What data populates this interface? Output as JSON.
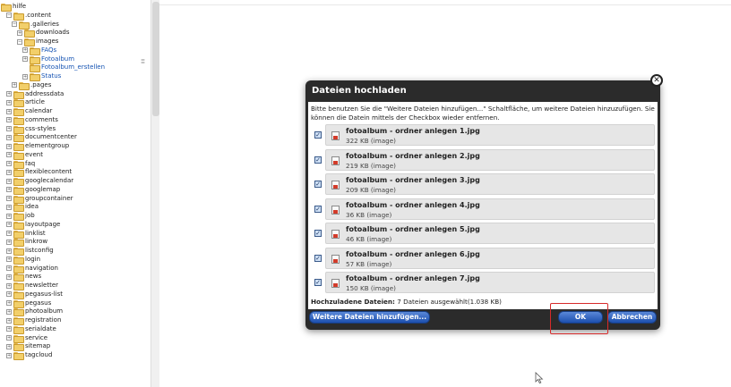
{
  "tree": {
    "items": [
      {
        "label": "hilfe",
        "level": 0,
        "toggle": ""
      },
      {
        "label": ".content",
        "level": 1,
        "toggle": "−"
      },
      {
        "label": ".galleries",
        "level": 2,
        "toggle": "−"
      },
      {
        "label": "downloads",
        "level": 3,
        "toggle": "+"
      },
      {
        "label": "images",
        "level": 3,
        "toggle": "−"
      },
      {
        "label": "FAQs",
        "level": 4,
        "toggle": "+",
        "blue": true
      },
      {
        "label": "Fotoalbum",
        "level": 4,
        "toggle": "+",
        "blue": true
      },
      {
        "label": "Fotoalbum_erstellen",
        "level": 4,
        "toggle": "",
        "blue": true
      },
      {
        "label": "Status",
        "level": 4,
        "toggle": "+",
        "blue": true
      },
      {
        "label": ".pages",
        "level": 2,
        "toggle": "+"
      },
      {
        "label": "addressdata",
        "level": 1,
        "toggle": "+"
      },
      {
        "label": "article",
        "level": 1,
        "toggle": "+"
      },
      {
        "label": "calendar",
        "level": 1,
        "toggle": "+"
      },
      {
        "label": "comments",
        "level": 1,
        "toggle": "+"
      },
      {
        "label": "css-styles",
        "level": 1,
        "toggle": "+"
      },
      {
        "label": "documentcenter",
        "level": 1,
        "toggle": "+"
      },
      {
        "label": "elementgroup",
        "level": 1,
        "toggle": "+"
      },
      {
        "label": "event",
        "level": 1,
        "toggle": "+"
      },
      {
        "label": "faq",
        "level": 1,
        "toggle": "+"
      },
      {
        "label": "flexiblecontent",
        "level": 1,
        "toggle": "+"
      },
      {
        "label": "googlecalendar",
        "level": 1,
        "toggle": "+"
      },
      {
        "label": "googlemap",
        "level": 1,
        "toggle": "+"
      },
      {
        "label": "groupcontainer",
        "level": 1,
        "toggle": "+"
      },
      {
        "label": "idea",
        "level": 1,
        "toggle": "+"
      },
      {
        "label": "job",
        "level": 1,
        "toggle": "+"
      },
      {
        "label": "layoutpage",
        "level": 1,
        "toggle": "+"
      },
      {
        "label": "linklist",
        "level": 1,
        "toggle": "+"
      },
      {
        "label": "linkrow",
        "level": 1,
        "toggle": "+"
      },
      {
        "label": "listconfig",
        "level": 1,
        "toggle": "+"
      },
      {
        "label": "login",
        "level": 1,
        "toggle": "+"
      },
      {
        "label": "navigation",
        "level": 1,
        "toggle": "+"
      },
      {
        "label": "news",
        "level": 1,
        "toggle": "+"
      },
      {
        "label": "newsletter",
        "level": 1,
        "toggle": "+"
      },
      {
        "label": "pegasus-list",
        "level": 1,
        "toggle": "+"
      },
      {
        "label": "pegasus",
        "level": 1,
        "toggle": "+"
      },
      {
        "label": "photoalbum",
        "level": 1,
        "toggle": "+"
      },
      {
        "label": "registration",
        "level": 1,
        "toggle": "+"
      },
      {
        "label": "serialdate",
        "level": 1,
        "toggle": "+"
      },
      {
        "label": "service",
        "level": 1,
        "toggle": "+"
      },
      {
        "label": "sitemap",
        "level": 1,
        "toggle": "+"
      },
      {
        "label": "tagcloud",
        "level": 1,
        "toggle": "+"
      }
    ]
  },
  "dialog": {
    "title": "Dateien hochladen",
    "close_icon": "close-icon",
    "intro": "Bitte benutzen Sie die \"Weitere Dateien hinzufügen...\" Schaltfläche, um weitere Dateien hinzuzufügen. Sie können die Datein mittels der Checkbox wieder entfernen.",
    "files": [
      {
        "name": "fotoalbum - ordner anlegen 1.jpg",
        "size": "322 KB (image)",
        "checked": true
      },
      {
        "name": "fotoalbum - ordner anlegen 2.jpg",
        "size": "219 KB (image)",
        "checked": true
      },
      {
        "name": "fotoalbum - ordner anlegen 3.jpg",
        "size": "209 KB (image)",
        "checked": true
      },
      {
        "name": "fotoalbum - ordner anlegen 4.jpg",
        "size": "36 KB (image)",
        "checked": true
      },
      {
        "name": "fotoalbum - ordner anlegen 5.jpg",
        "size": "46 KB (image)",
        "checked": true
      },
      {
        "name": "fotoalbum - ordner anlegen 6.jpg",
        "size": "57 KB (image)",
        "checked": true
      },
      {
        "name": "fotoalbum - ordner anlegen 7.jpg",
        "size": "150 KB (image)",
        "checked": true
      }
    ],
    "summary_label": "Hochzuladene Dateien:",
    "summary_value": "7 Dateien ausgewählt(1.038 KB)",
    "add_button": "Weitere Dateien hinzufügen...",
    "ok_button": "OK",
    "cancel_button": "Abbrechen"
  },
  "colors": {
    "dialog_bg": "#2b2b2b",
    "button_blue": "#1c4fae",
    "highlight_red": "#d62a2a",
    "folder_yellow": "#f2cf6a",
    "tree_link_blue": "#1553b3"
  }
}
